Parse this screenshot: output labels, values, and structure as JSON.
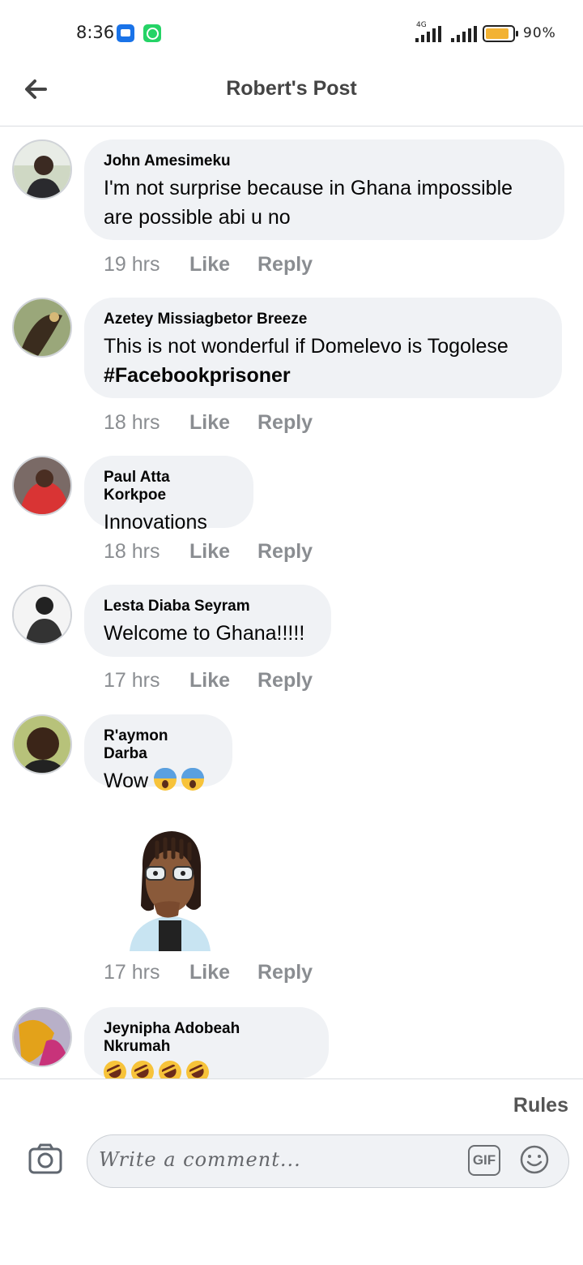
{
  "status_bar": {
    "time": "8:36",
    "network": "4G",
    "battery_pct": "90%",
    "battery_level": 0.9,
    "icons": [
      "messages-icon",
      "whatsapp-icon",
      "signal-icon",
      "battery-icon"
    ]
  },
  "header": {
    "title": "Robert's Post",
    "back_icon": "back-arrow-icon"
  },
  "comments": [
    {
      "author": "John Amesimeku",
      "text": "I'm not surprise  because in Ghana impossible are possible abi u no",
      "time": "19 hrs",
      "like": "Like",
      "reply": "Reply"
    },
    {
      "author": "Azetey Missiagbetor Breeze",
      "text": "This is not wonderful if Domelevo is Togolese",
      "hashtag": "#Facebookprisoner",
      "time": "18 hrs",
      "like": "Like",
      "reply": "Reply"
    },
    {
      "author": "Paul Atta Korkpoe",
      "text": "Innovations",
      "time": "18 hrs",
      "like": "Like",
      "reply": "Reply"
    },
    {
      "author": "Lesta Diaba Seyram",
      "text": "Welcome to Ghana!!!!!",
      "time": "17 hrs",
      "like": "Like",
      "reply": "Reply"
    },
    {
      "author": "R'aymon Darba",
      "text": "Wow",
      "emojis": [
        "face-screaming-in-fear",
        "face-screaming-in-fear"
      ],
      "sticker": "thinking-avatar-sticker",
      "time": "17 hrs",
      "like": "Like",
      "reply": "Reply"
    },
    {
      "author": "Jeynipha Adobeah Nkrumah",
      "emojis": [
        "rolling-on-the-floor-laughing",
        "rolling-on-the-floor-laughing",
        "rolling-on-the-floor-laughing",
        "rolling-on-the-floor-laughing"
      ]
    }
  ],
  "footer": {
    "rules": "Rules",
    "placeholder": "Write a comment...",
    "gif": "GIF",
    "icons": [
      "camera-icon",
      "gif-icon",
      "emoji-icon"
    ]
  },
  "colors": {
    "bubble": "#f0f2f5",
    "meta": "#8a8d91",
    "battery": "#f2b233"
  }
}
